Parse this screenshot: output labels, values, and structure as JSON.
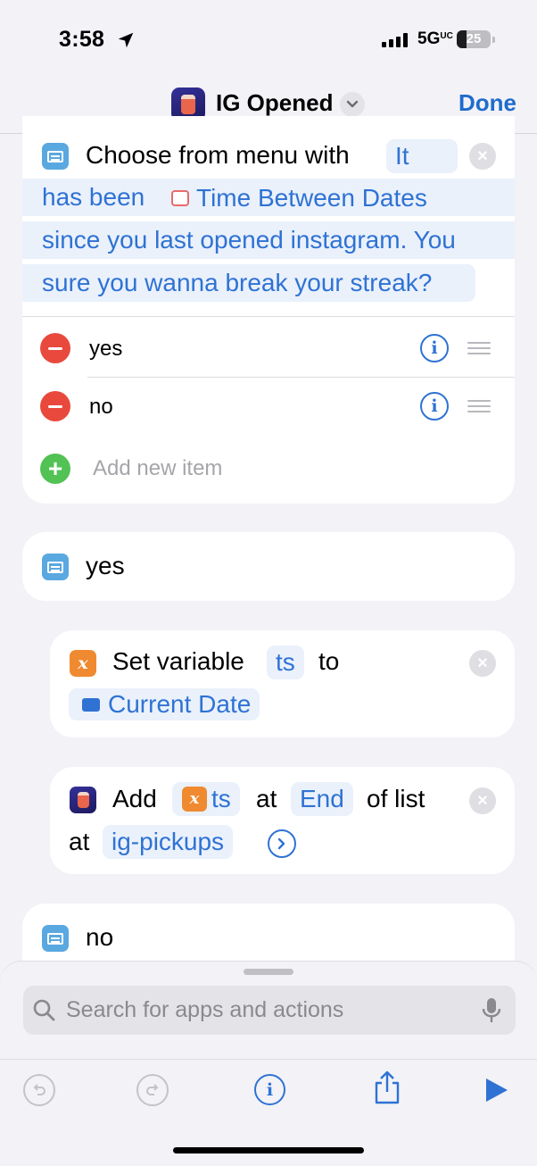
{
  "status": {
    "time": "3:58",
    "network": "5G",
    "network_sup": "UC",
    "battery": "25"
  },
  "nav": {
    "title": "IG Opened",
    "done_label": "Done"
  },
  "menu_action": {
    "title": "Choose from menu with",
    "prompt_line1_word": "It",
    "prompt_line2_prefix": "has been",
    "prompt_variable": "Time Between Dates",
    "prompt_line3": "since you last opened instagram. You",
    "prompt_line4": "sure you wanna break your streak?",
    "items": [
      {
        "label": "yes"
      },
      {
        "label": "no"
      }
    ],
    "add_placeholder": "Add new item"
  },
  "case_yes": {
    "label": "yes"
  },
  "set_variable": {
    "label": "Set variable",
    "variable": "ts",
    "to": "to",
    "value": "Current Date"
  },
  "add_to_list": {
    "label": "Add",
    "variable": "ts",
    "at": "at",
    "position": "End",
    "of_list": "of list",
    "at2": "at",
    "list_name": "ig-pickups"
  },
  "case_no": {
    "label": "no"
  },
  "search": {
    "placeholder": "Search for apps and actions"
  },
  "colors": {
    "accent": "#2f72d4",
    "delete": "#e9493d",
    "add": "#52c254",
    "variable": "#f08a30",
    "menu": "#5aa8e0"
  },
  "icons": {
    "toolbar": [
      "undo-icon",
      "redo-icon",
      "info-icon",
      "share-icon",
      "play-icon"
    ]
  }
}
